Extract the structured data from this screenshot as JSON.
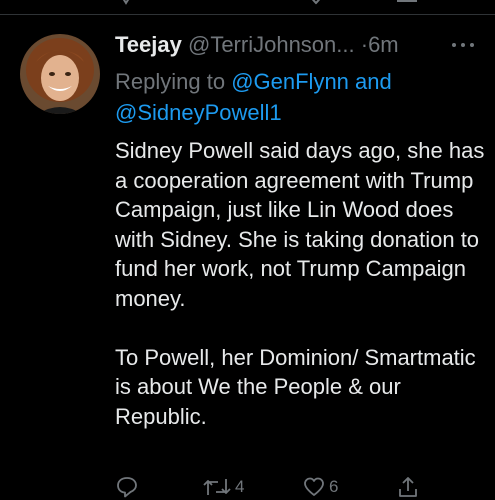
{
  "tweet": {
    "display_name": "Teejay",
    "handle": "@TerriJohnson...",
    "separator": "·",
    "time": "6m",
    "reply_prefix": "Replying to",
    "reply_mention_1": "@GenFlynn",
    "reply_conjunction": "and",
    "reply_mention_2": "@SidneyPowell1",
    "paragraph_1": "Sidney Powell said days ago, she has a cooperation agreement with Trump Campaign, just like Lin Wood does with Sidney. She is taking donation to fund her work, not Trump Campaign money.",
    "paragraph_2": "To Powell, her Dominion/ Smartmatic is about We the People & our Republic."
  },
  "actions": {
    "reply_icon": "reply-icon",
    "retweet_icon": "retweet-icon",
    "retweet_count": "4",
    "like_icon": "like-icon",
    "like_count": "6",
    "share_icon": "share-icon"
  },
  "colors": {
    "background": "#000000",
    "text": "#e7e9ea",
    "muted": "#71767b",
    "link": "#1d9bf0"
  }
}
